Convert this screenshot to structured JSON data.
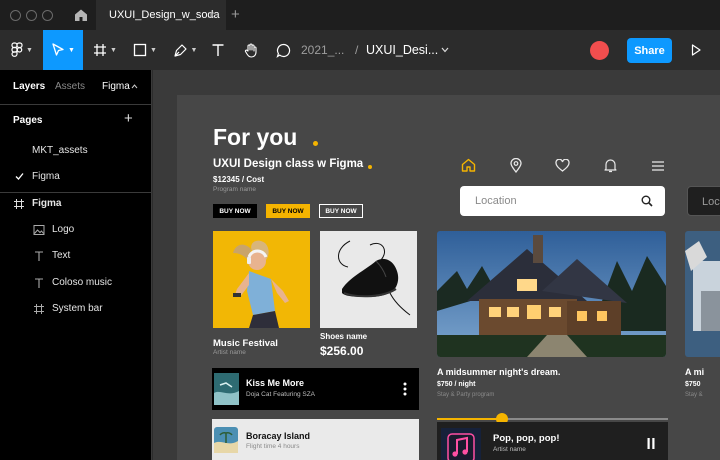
{
  "window": {
    "tab_title": "UXUI_Design_w_soda",
    "close_glyph": "×",
    "new_tab_glyph": "+"
  },
  "toolbar": {
    "breadcrumb_project": "2021_...",
    "breadcrumb_sep": "/",
    "breadcrumb_file": "UXUI_Desi...",
    "share_label": "Share",
    "accent": "#0d99ff"
  },
  "left_panel": {
    "tabs": [
      "Layers",
      "Assets",
      "Figma"
    ],
    "pages_title": "Pages",
    "pages": [
      {
        "label": "MKT_assets",
        "checked": false
      },
      {
        "label": "Figma",
        "checked": true
      }
    ],
    "frame": {
      "label": "Figma",
      "icon": "frame-icon"
    },
    "layers": [
      {
        "label": "Logo",
        "icon": "image-icon"
      },
      {
        "label": "Text",
        "icon": "text-icon"
      },
      {
        "label": "Coloso music",
        "icon": "text-icon"
      },
      {
        "label": "System bar",
        "icon": "frame-icon"
      }
    ]
  },
  "design": {
    "heading": "For you",
    "class_title": "UXUI Design class w Figma",
    "cost": "$12345 / Cost",
    "program": "Program name",
    "buy_label": "BUY NOW",
    "accent": "#f5b400",
    "card1": {
      "title": "Music Festival",
      "subtitle": "Artist name"
    },
    "card2": {
      "title": "Shoes name",
      "price": "$256.00"
    },
    "search_placeholder": "Location",
    "search2_placeholder": "Loc",
    "house": {
      "title": "A midsummer night's dream.",
      "price": "$750 / night",
      "subtitle": "Stay & Party program"
    },
    "house2": {
      "title": "A mi",
      "price": "$750",
      "subtitle": "Stay &"
    },
    "track1": {
      "title": "Kiss Me More",
      "artist": "Doja Cat Featuring SZA"
    },
    "track2": {
      "title": "Boracay Island",
      "subtitle": "Flight time 4 hours"
    },
    "now_playing": {
      "title": "Pop, pop, pop!",
      "artist": "Artist name",
      "progress": 0.28
    }
  }
}
